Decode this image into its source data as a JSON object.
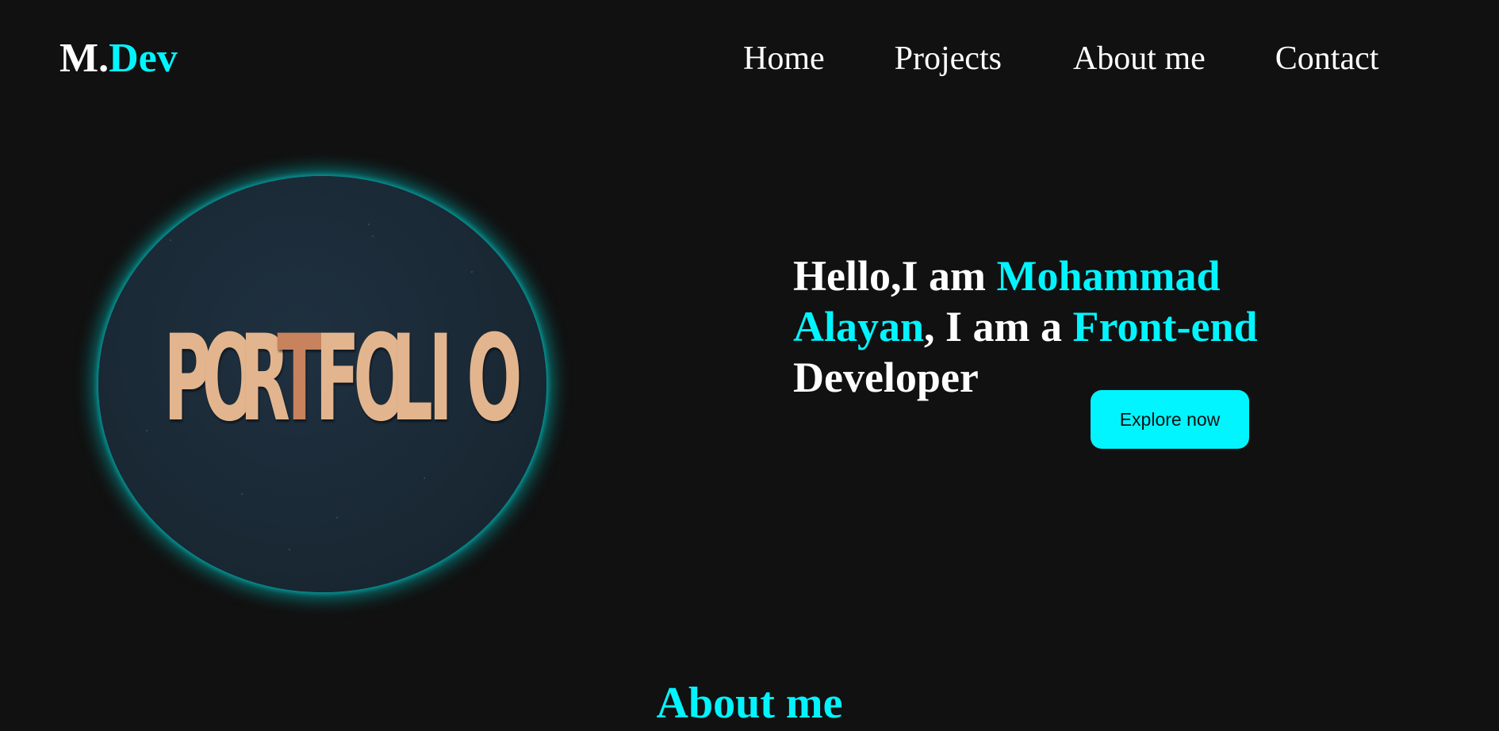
{
  "logo": {
    "main": "M.",
    "accent": "Dev"
  },
  "nav": {
    "items": [
      {
        "label": "Home"
      },
      {
        "label": "Projects"
      },
      {
        "label": "About me"
      },
      {
        "label": "Contact"
      }
    ]
  },
  "hero": {
    "image_word": [
      "P",
      "O",
      "R",
      "T",
      "F",
      "O",
      "L",
      "I",
      "O"
    ],
    "text": {
      "part1": "Hello,I am ",
      "name": "Mohammad Alayan",
      "part2": ", I am a ",
      "role": "Front-end",
      "part3": " Developer"
    },
    "button_label": "Explore now"
  },
  "about": {
    "heading": "About me"
  },
  "colors": {
    "accent": "#00f5ff",
    "background": "#111111",
    "text": "#ffffff"
  }
}
